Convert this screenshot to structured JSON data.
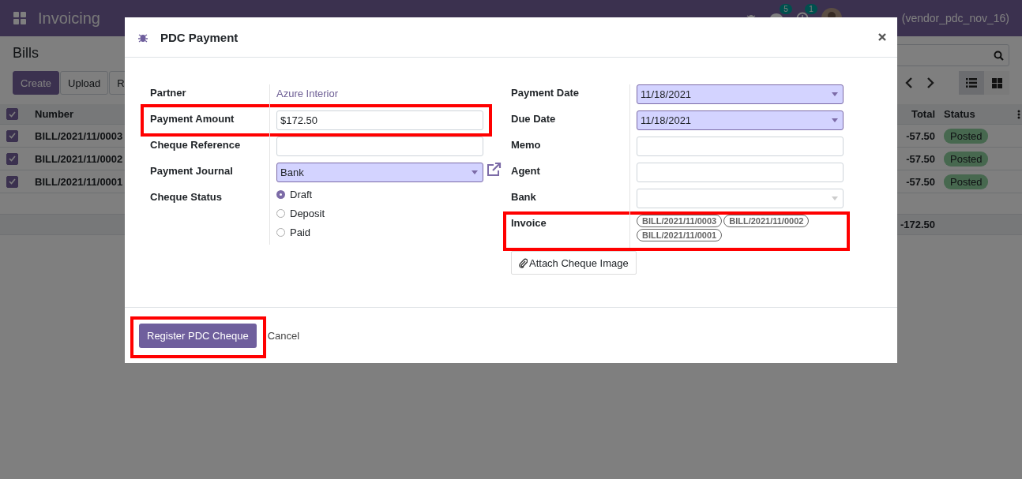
{
  "navbar": {
    "app_name": "Invoicing",
    "chat_count": "5",
    "activity_count": "1",
    "user": "(vendor_pdc_nov_16)"
  },
  "control_panel": {
    "title": "Bills",
    "buttons": [
      {
        "label": "Create",
        "primary": true
      },
      {
        "label": "Upload",
        "primary": false
      },
      {
        "label": "R",
        "primary": false
      }
    ],
    "views": [
      {
        "kind": "list",
        "selected": true
      },
      {
        "kind": "kanban",
        "selected": false
      }
    ]
  },
  "table": {
    "columns": [
      "Number",
      "Total",
      "Status"
    ],
    "all_checked": true,
    "rows": [
      {
        "checked": true,
        "number": "BILL/2021/11/0003",
        "total": "-57.50",
        "status": "Posted"
      },
      {
        "checked": true,
        "number": "BILL/2021/11/0002",
        "total": "-57.50",
        "status": "Posted"
      },
      {
        "checked": true,
        "number": "BILL/2021/11/0001",
        "total": "-57.50",
        "status": "Posted"
      }
    ],
    "sum": "-172.50"
  },
  "dialog": {
    "title": "PDC Payment",
    "left_fields": [
      {
        "label": "Partner",
        "kind": "text",
        "value": "Azure Interior",
        "highlighted": false
      },
      {
        "label": "Payment Amount",
        "kind": "input",
        "value": "$172.50",
        "required": false,
        "highlighted": true
      },
      {
        "label": "Cheque Reference",
        "kind": "input",
        "required": false,
        "highlighted": false
      },
      {
        "label": "Payment Journal",
        "kind": "select",
        "value": "Bank",
        "required": true,
        "link": true,
        "highlighted": false
      },
      {
        "label": "Cheque Status",
        "kind": "radio",
        "options": [
          {
            "label": "Draft",
            "selected": true
          },
          {
            "label": "Deposit",
            "selected": false
          },
          {
            "label": "Paid",
            "selected": false
          }
        ],
        "highlighted": false
      }
    ],
    "right_fields": [
      {
        "label": "Payment Date",
        "kind": "select",
        "value": "11/18/2021",
        "required": true,
        "highlighted": false
      },
      {
        "label": "Due Date",
        "kind": "select",
        "value": "11/18/2021",
        "required": true,
        "highlighted": false
      },
      {
        "label": "Memo",
        "kind": "input",
        "required": false,
        "highlighted": false
      },
      {
        "label": "Agent",
        "kind": "input",
        "required": false,
        "highlighted": false
      },
      {
        "label": "Bank",
        "kind": "select",
        "required": false,
        "highlighted": false
      },
      {
        "label": "Invoice",
        "kind": "tags",
        "tags": [
          "BILL/2021/11/0003",
          "BILL/2021/11/0002",
          "BILL/2021/11/0001"
        ],
        "highlighted": true
      }
    ],
    "attach_button": "Attach Cheque Image",
    "primary_button": {
      "label": "Register PDC Cheque",
      "highlighted": true
    },
    "cancel": "Cancel"
  }
}
